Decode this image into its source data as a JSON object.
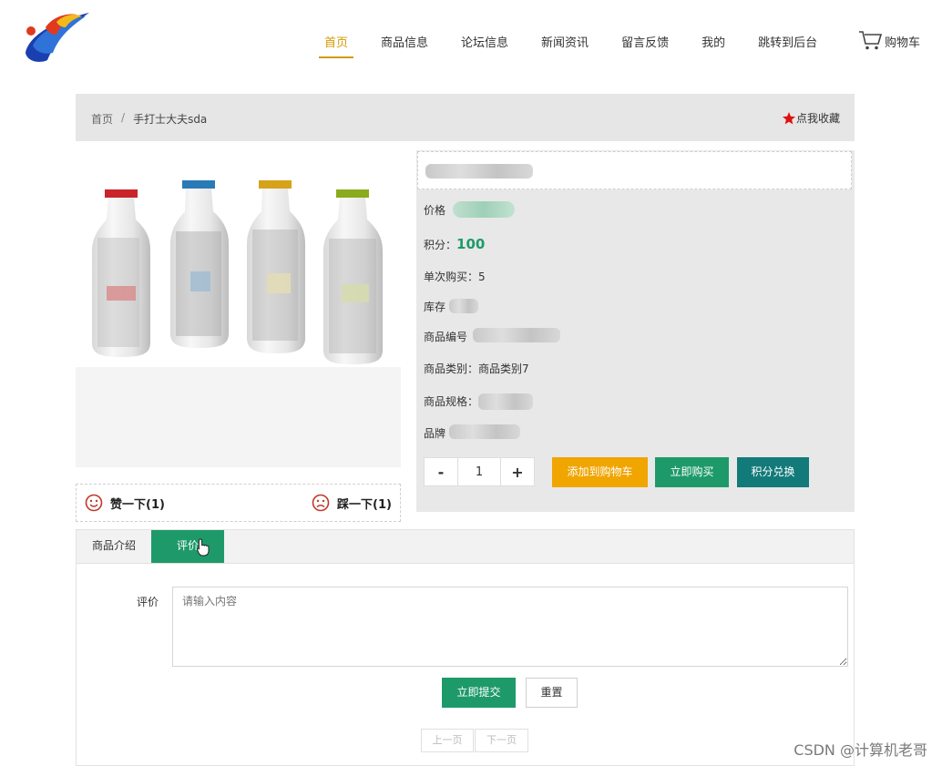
{
  "nav": {
    "items": [
      "首页",
      "商品信息",
      "论坛信息",
      "新闻资讯",
      "留言反馈",
      "我的",
      "跳转到后台"
    ],
    "cart_label": "购物车"
  },
  "breadcrumb": {
    "home": "首页",
    "separator": "/",
    "current": "手打士大夫sda",
    "favorite_label": "点我收藏"
  },
  "vote": {
    "like_label": "赞一下(1)",
    "dislike_label": "踩一下(1)"
  },
  "product": {
    "price_label": "价格",
    "points_label": "积分：",
    "points_value": "100",
    "per_purchase": "单次购买：5",
    "stock_label": "库存",
    "code_label": "商品编号",
    "category": "商品类别：商品类别7",
    "spec_label": "商品规格：",
    "brand_label": "品牌"
  },
  "purchase": {
    "minus": "-",
    "quantity": "1",
    "plus": "+",
    "add_to_cart": "添加到购物车",
    "buy_now": "立即购买",
    "redeem_points": "积分兑换"
  },
  "tabs": [
    "商品介绍",
    "评价"
  ],
  "review": {
    "label": "评价",
    "placeholder": "请输入内容",
    "submit": "立即提交",
    "reset": "重置"
  },
  "pager": {
    "prev": "上一页",
    "next": "下一页"
  },
  "watermark": "CSDN @计算机老哥",
  "colors": {
    "accent_nav": "#d49a00",
    "green": "#1e9a6a",
    "orange": "#f0a500",
    "teal": "#137a7a",
    "favorite_star": "#e01010"
  }
}
